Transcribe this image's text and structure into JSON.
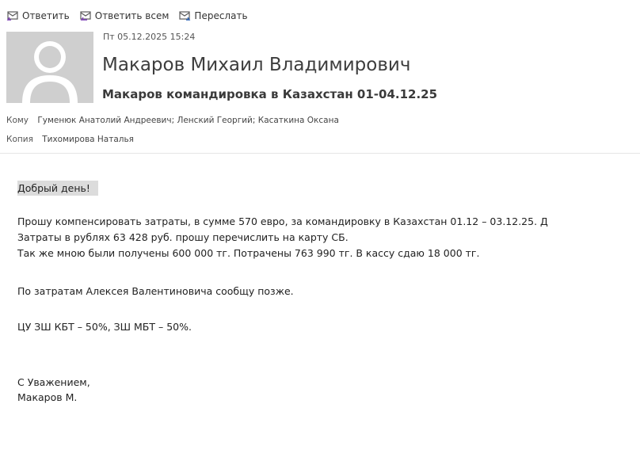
{
  "toolbar": {
    "reply_label": "Ответить",
    "reply_all_label": "Ответить всем",
    "forward_label": "Переслать"
  },
  "header": {
    "date": "Пт 05.12.2025 15:24",
    "sender": "Макаров Михаил Владимирович",
    "subject": "Макаров командировка в Казахстан 01-04.12.25",
    "to_label": "Кому",
    "to_value": "Гуменюк Анатолий Андреевич; Ленский Георгий; Касаткина Оксана",
    "cc_label": "Копия",
    "cc_value": "Тихомирова Наталья"
  },
  "body": {
    "greeting": "Добрый день!",
    "line1": "Прошу компенсировать затраты, в сумме 570 евро, за командировку в Казахстан 01.12 – 03.12.25.  Д",
    "line2": "Затраты в рублях 63 428 руб. прошу перечислить на карту СБ.",
    "line3": "Так же мною были получены 600 000 тг. Потрачены  763 990 тг. В кассу сдаю 18 000 тг.",
    "line4": "По затратам Алексея Валентиновича сообщу позже.",
    "line5": "ЦУ ЗШ КБТ – 50%, ЗШ МБТ – 50%.",
    "sign1": "С Уважением,",
    "sign2": "Макаров М."
  }
}
